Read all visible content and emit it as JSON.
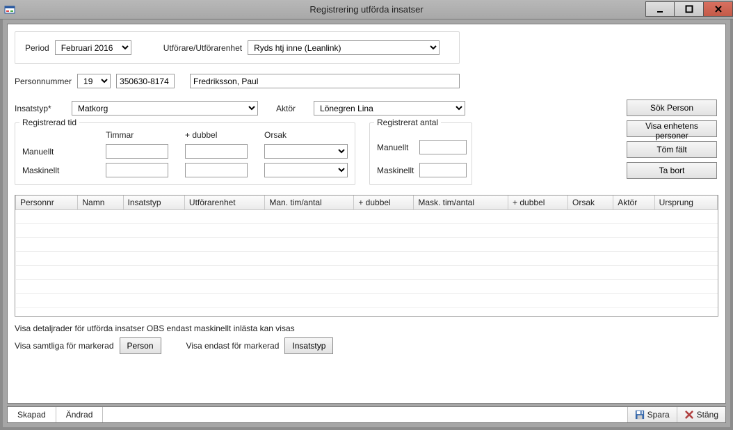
{
  "window": {
    "title": "Registrering utförda insatser"
  },
  "top": {
    "period_label": "Period",
    "period_value": "Februari 2016",
    "utforare_label": "Utförare/Utförarenhet",
    "utforare_value": "Ryds htj inne (Leanlink)"
  },
  "person": {
    "label": "Personnummer",
    "century": "19",
    "number": "350630-8174",
    "name": "Fredriksson, Paul"
  },
  "insats": {
    "type_label": "Insatstyp*",
    "type_value": "Matkorg",
    "aktor_label": "Aktör",
    "aktor_value": "Lönegren Lina"
  },
  "tid": {
    "legend": "Registrerad tid",
    "timmar_hdr": "Timmar",
    "dubbel_hdr": "+ dubbel",
    "orsak_hdr": "Orsak",
    "manuellt_label": "Manuellt",
    "maskinellt_label": "Maskinellt",
    "manuellt_timmar": "",
    "manuellt_dubbel": "",
    "manuellt_orsak": "",
    "maskinellt_timmar": "",
    "maskinellt_dubbel": "",
    "maskinellt_orsak": ""
  },
  "antal": {
    "legend": "Registrerat antal",
    "manuellt_label": "Manuellt",
    "maskinellt_label": "Maskinellt",
    "manuellt_value": "",
    "maskinellt_value": ""
  },
  "actions": {
    "sok_person": "Sök Person",
    "visa_enhet": "Visa enhetens personer",
    "tom_falt": "Töm fält",
    "ta_bort": "Ta bort"
  },
  "table": {
    "columns": [
      "Personnr",
      "Namn",
      "Insatstyp",
      "Utförarenhet",
      "Man. tim/antal",
      "+ dubbel",
      "Mask. tim/antal",
      "+ dubbel",
      "Orsak",
      "Aktör",
      "Ursprung"
    ]
  },
  "detail": {
    "note": "Visa detaljrader för utförda insatser OBS endast maskinellt inlästa kan visas",
    "visa_samtliga_label": "Visa samtliga för markerad",
    "person_btn": "Person",
    "visa_endast_label": "Visa endast för markerad",
    "insatstyp_btn": "Insatstyp"
  },
  "status": {
    "skapad": "Skapad",
    "andrad": "Ändrad",
    "spara": "Spara",
    "stang": "Stäng"
  }
}
